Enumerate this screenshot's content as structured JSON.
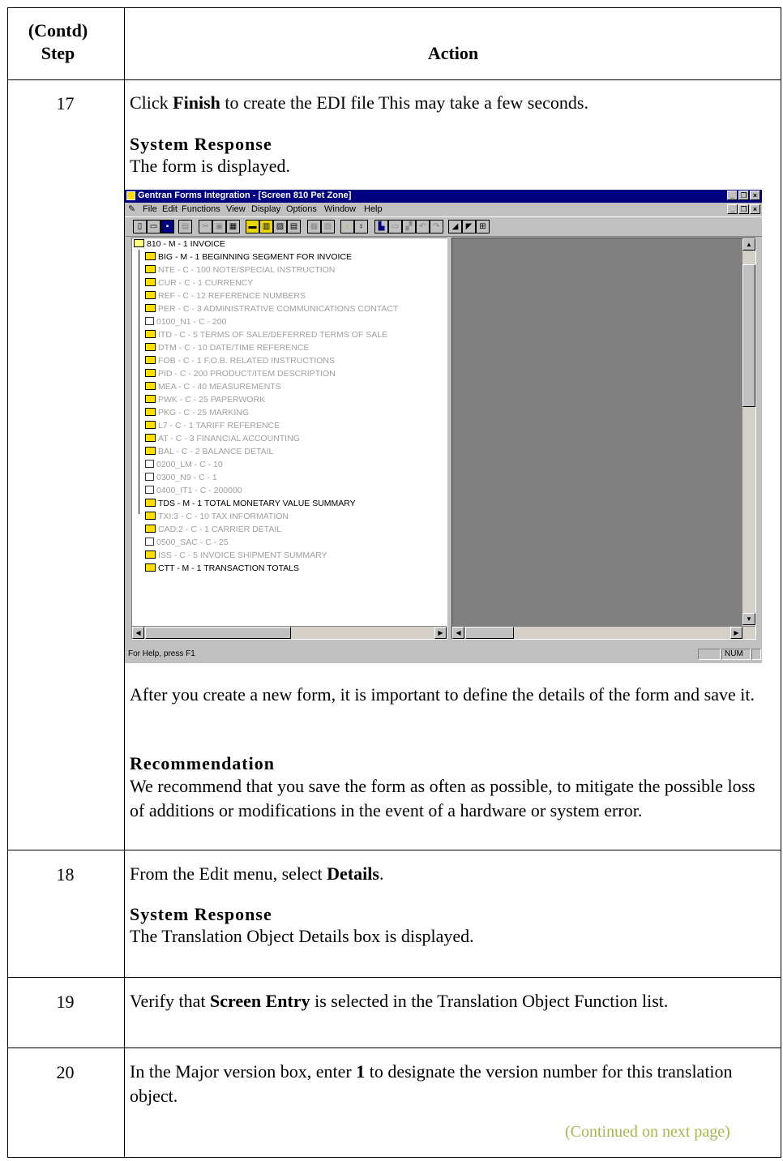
{
  "header": {
    "step_line1": "(Contd)",
    "step_line2": "Step",
    "action": "Action"
  },
  "rows": [
    {
      "step": "17",
      "click_prefix": "Click ",
      "click_bold": "Finish",
      "click_suffix": " to create the EDI file This may take a few seconds.",
      "sys_heading": "System Response",
      "sys_text": "The form is displayed.",
      "after_text": "After you create a new form, it is important to define the details of the form and save it.",
      "rec_heading": "Recommendation",
      "rec_text": "We recommend that you save the form as often as possible, to mitigate the possible loss of additions or modifications in the event of a hardware or system error."
    },
    {
      "step": "18",
      "text_prefix": "From the Edit menu, select ",
      "text_bold": "Details",
      "text_suffix": ".",
      "sys_heading": "System Response",
      "sys_text": "The Translation Object Details box is displayed."
    },
    {
      "step": "19",
      "text_prefix": "Verify that ",
      "text_bold": "Screen Entry",
      "text_suffix": " is selected in the Translation Object Function list."
    },
    {
      "step": "20",
      "text_prefix": "In the Major version box, enter ",
      "text_bold": "1",
      "text_suffix": " to designate the version number for this translation object."
    }
  ],
  "continued": "(Continued on next page)",
  "continued_color": "#a6b74e",
  "screenshot": {
    "title": "Gentran Forms Integration - [Screen 810 Pet Zone]",
    "title_bar_color": "#000080",
    "menu": [
      "File",
      "Edit",
      "Functions",
      "View",
      "Display",
      "Options",
      "Window",
      "Help"
    ],
    "tree_root": "810 - M - 1 INVOICE",
    "tree_items": [
      {
        "label": "BIG - M - 1 BEGINNING SEGMENT FOR INVOICE",
        "dim": false,
        "kind": "seg"
      },
      {
        "label": "NTE - C - 100 NOTE/SPECIAL INSTRUCTION",
        "dim": true,
        "kind": "seg"
      },
      {
        "label": "CUR - C - 1 CURRENCY",
        "dim": true,
        "kind": "seg"
      },
      {
        "label": "REF - C - 12 REFERENCE NUMBERS",
        "dim": true,
        "kind": "seg"
      },
      {
        "label": "PER - C - 3 ADMINISTRATIVE COMMUNICATIONS CONTACT",
        "dim": true,
        "kind": "seg"
      },
      {
        "label": "0100_N1 - C - 200",
        "dim": true,
        "kind": "grp"
      },
      {
        "label": "ITD - C - 5 TERMS OF SALE/DEFERRED TERMS OF SALE",
        "dim": true,
        "kind": "seg"
      },
      {
        "label": "DTM - C - 10 DATE/TIME REFERENCE",
        "dim": true,
        "kind": "seg"
      },
      {
        "label": "FOB - C - 1 F.O.B. RELATED INSTRUCTIONS",
        "dim": true,
        "kind": "seg"
      },
      {
        "label": "PID - C - 200 PRODUCT/ITEM DESCRIPTION",
        "dim": true,
        "kind": "seg"
      },
      {
        "label": "MEA - C - 40 MEASUREMENTS",
        "dim": true,
        "kind": "seg"
      },
      {
        "label": "PWK - C - 25 PAPERWORK",
        "dim": true,
        "kind": "seg"
      },
      {
        "label": "PKG - C - 25 MARKING",
        "dim": true,
        "kind": "seg"
      },
      {
        "label": "L7 - C - 1 TARIFF REFERENCE",
        "dim": true,
        "kind": "seg"
      },
      {
        "label": "AT - C - 3 FINANCIAL ACCOUNTING",
        "dim": true,
        "kind": "seg"
      },
      {
        "label": "BAL - C - 2 BALANCE DETAIL",
        "dim": true,
        "kind": "seg"
      },
      {
        "label": "0200_LM - C - 10",
        "dim": true,
        "kind": "grp"
      },
      {
        "label": "0300_N9 - C - 1",
        "dim": true,
        "kind": "grp"
      },
      {
        "label": "0400_IT1 - C - 200000",
        "dim": true,
        "kind": "grp"
      },
      {
        "label": "TDS - M - 1 TOTAL MONETARY VALUE SUMMARY",
        "dim": false,
        "kind": "seg"
      },
      {
        "label": "TXI:3 - C - 10 TAX INFORMATION",
        "dim": true,
        "kind": "seg"
      },
      {
        "label": "CAD:2 - C - 1 CARRIER DETAIL",
        "dim": true,
        "kind": "seg"
      },
      {
        "label": "0500_SAC - C - 25",
        "dim": true,
        "kind": "grp"
      },
      {
        "label": "ISS - C - 5 INVOICE SHIPMENT SUMMARY",
        "dim": true,
        "kind": "seg"
      },
      {
        "label": "CTT - M - 1 TRANSACTION TOTALS",
        "dim": false,
        "kind": "seg"
      }
    ],
    "status_text": "For Help, press F1",
    "status_num": "NUM"
  }
}
